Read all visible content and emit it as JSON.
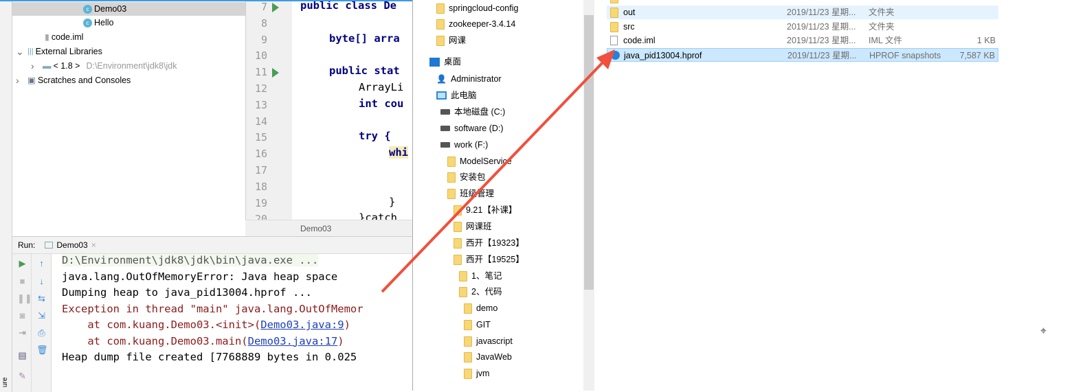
{
  "project_tree": [
    {
      "label": "Demo03",
      "type": "class",
      "selected": true
    },
    {
      "label": "Hello",
      "type": "class"
    },
    {
      "label": "code.iml",
      "type": "file"
    },
    {
      "label": "External Libraries",
      "type": "libraries",
      "expanded": true
    },
    {
      "label": "< 1.8 >",
      "path": "D:\\Environment\\jdk8\\jdk",
      "type": "sdk"
    },
    {
      "label": "Scratches and Consoles",
      "type": "scratches"
    }
  ],
  "editor": {
    "tab": "Demo03",
    "lines": [
      {
        "n": "7",
        "code": "public class De",
        "run": true
      },
      {
        "n": "8",
        "code": ""
      },
      {
        "n": "9",
        "code": "byte[] arra"
      },
      {
        "n": "10",
        "code": ""
      },
      {
        "n": "11",
        "code": "public stat",
        "run": true
      },
      {
        "n": "12",
        "code": "ArrayLi"
      },
      {
        "n": "13",
        "code": "int cou"
      },
      {
        "n": "14",
        "code": ""
      },
      {
        "n": "15",
        "code": "try {"
      },
      {
        "n": "16",
        "code": "whi"
      },
      {
        "n": "17",
        "code": ""
      },
      {
        "n": "18",
        "code": ""
      },
      {
        "n": "19",
        "code": "}"
      },
      {
        "n": "20",
        "code": "}catch"
      }
    ]
  },
  "run_panel": {
    "label": "Run:",
    "tab": "Demo03",
    "console": [
      {
        "text": "D:\\Environment\\jdk8\\jdk\\bin\\java.exe ...",
        "style": "cmd"
      },
      {
        "text": "java.lang.OutOfMemoryError: Java heap space",
        "style": "out"
      },
      {
        "text": "Dumping heap to java_pid13004.hprof ...",
        "style": "out"
      },
      {
        "text": "Exception in thread \"main\" java.lang.OutOfMemor",
        "style": "err"
      },
      {
        "prefix": "    at com.kuang.Demo03.<init>(",
        "link": "Demo03.java:9",
        "suffix": ")",
        "style": "err"
      },
      {
        "prefix": "    at com.kuang.Demo03.main(",
        "link": "Demo03.java:17",
        "suffix": ")",
        "style": "err"
      },
      {
        "text": "Heap dump file created [7768889 bytes in 0.025",
        "style": "out"
      }
    ],
    "side_label": "ure"
  },
  "explorer_nav": [
    {
      "label": "springcloud-config",
      "icon": "folder"
    },
    {
      "label": "zookeeper-3.4.14",
      "icon": "folder"
    },
    {
      "label": "网课",
      "icon": "folder"
    },
    {
      "label": "桌面",
      "icon": "desktop"
    },
    {
      "label": "Administrator",
      "icon": "user"
    },
    {
      "label": "此电脑",
      "icon": "computer"
    },
    {
      "label": "本地磁盘 (C:)",
      "icon": "drive"
    },
    {
      "label": "software (D:)",
      "icon": "drive"
    },
    {
      "label": "work (F:)",
      "icon": "drive"
    },
    {
      "label": "ModelService",
      "icon": "folder"
    },
    {
      "label": "安装包",
      "icon": "folder"
    },
    {
      "label": "班级管理",
      "icon": "folder"
    },
    {
      "label": "9.21【补课】",
      "icon": "folder"
    },
    {
      "label": "网课班",
      "icon": "folder"
    },
    {
      "label": "西开【19323】",
      "icon": "folder"
    },
    {
      "label": "西开【19525】",
      "icon": "folder"
    },
    {
      "label": "1、笔记",
      "icon": "folder"
    },
    {
      "label": "2、代码",
      "icon": "folder"
    },
    {
      "label": "demo",
      "icon": "folder"
    },
    {
      "label": "GIT",
      "icon": "folder"
    },
    {
      "label": "javascript",
      "icon": "folder"
    },
    {
      "label": "JavaWeb",
      "icon": "folder"
    },
    {
      "label": "jvm",
      "icon": "folder"
    }
  ],
  "explorer_files": [
    {
      "name": "out",
      "date": "2019/11/23 星期...",
      "type": "文件夹",
      "size": "",
      "icon": "folder",
      "state": "hover"
    },
    {
      "name": "src",
      "date": "2019/11/23 星期...",
      "type": "文件夹",
      "size": "",
      "icon": "folder"
    },
    {
      "name": "code.iml",
      "date": "2019/11/23 星期...",
      "type": "IML 文件",
      "size": "1 KB",
      "icon": "file"
    },
    {
      "name": "java_pid13004.hprof",
      "date": "2019/11/23 星期...",
      "type": "HPROF snapshots",
      "size": "7,587 KB",
      "icon": "hprof",
      "state": "selected"
    }
  ],
  "colors": {
    "annotation_arrow": "#f0503c",
    "selection": "#cce8ff",
    "error_text": "#8b1a1a",
    "link": "#1c3fb8"
  }
}
